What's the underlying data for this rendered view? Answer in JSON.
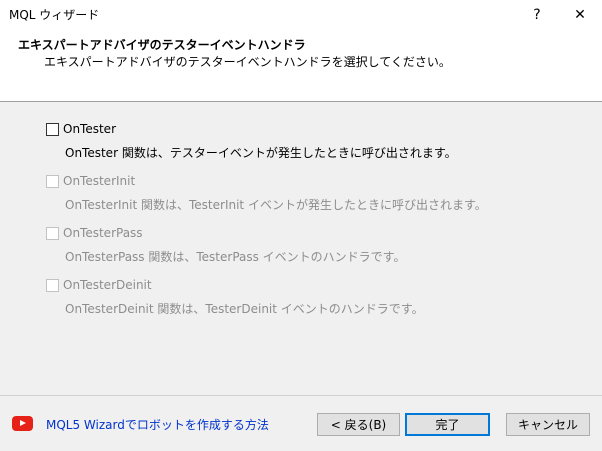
{
  "window": {
    "title": "MQL ウィザード",
    "help_glyph": "?",
    "close_glyph": "✕"
  },
  "header": {
    "title": "エキスパートアドバイザのテスターイベントハンドラ",
    "subtitle": "エキスパートアドバイザのテスターイベントハンドラを選択してください。"
  },
  "options": [
    {
      "label": "OnTester",
      "checked": false,
      "enabled": true,
      "description": "OnTester 関数は、テスターイベントが発生したときに呼び出されます。"
    },
    {
      "label": "OnTesterInit",
      "checked": false,
      "enabled": false,
      "description": "OnTesterInit 関数は、TesterInit イベントが発生したときに呼び出されます。"
    },
    {
      "label": "OnTesterPass",
      "checked": false,
      "enabled": false,
      "description": "OnTesterPass 関数は、TesterPass イベントのハンドラです。"
    },
    {
      "label": "OnTesterDeinit",
      "checked": false,
      "enabled": false,
      "description": "OnTesterDeinit 関数は、TesterDeinit イベントのハンドラです。"
    }
  ],
  "footer": {
    "link_text": "MQL5 Wizardでロボットを作成する方法",
    "link_color": "#0033cc",
    "youtube_color": "#e62117",
    "back_label": "< 戻る(B)",
    "finish_label": "完了",
    "cancel_label": "キャンセル"
  }
}
